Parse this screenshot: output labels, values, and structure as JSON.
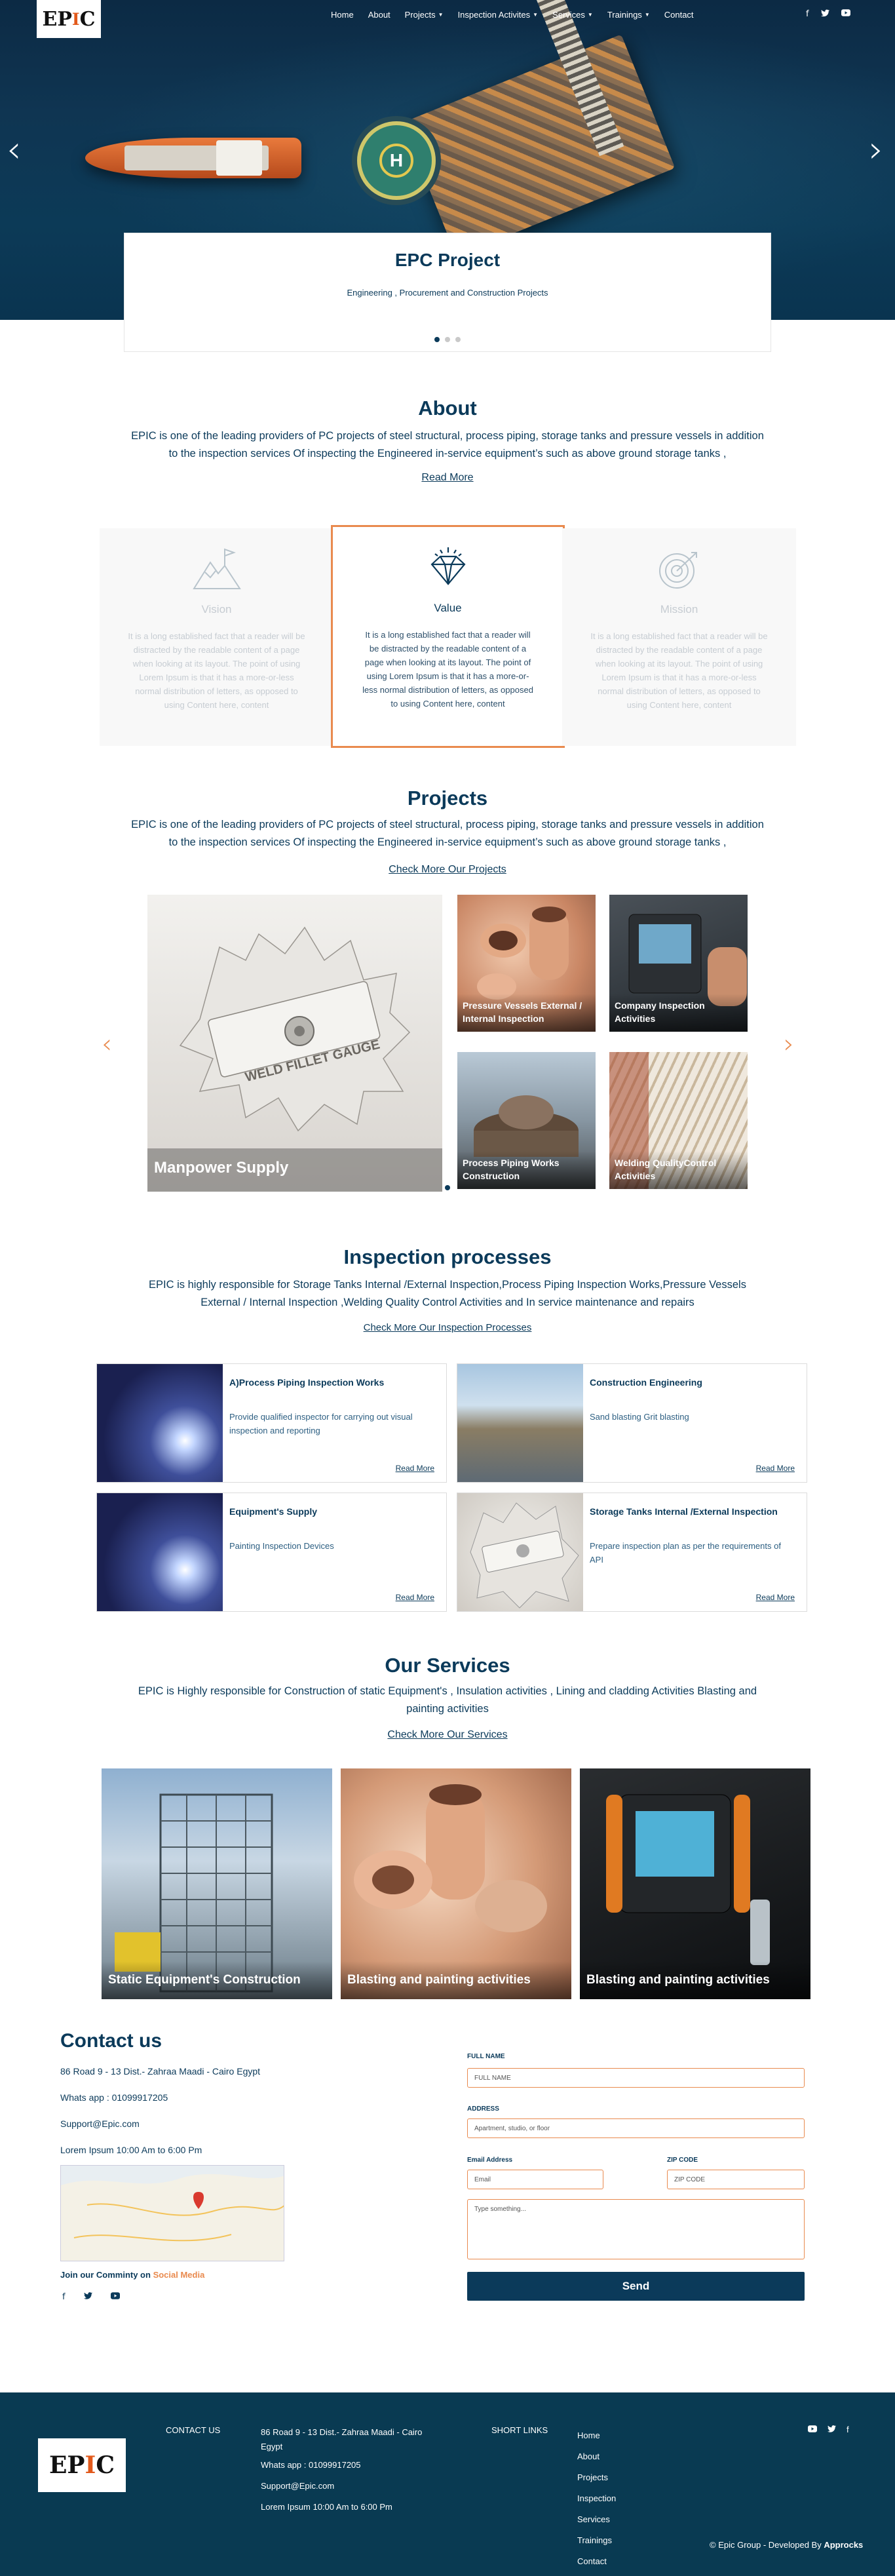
{
  "brand": {
    "logo_main": "EP",
    "logo_accent": "I",
    "logo_end": "C"
  },
  "nav": {
    "items": [
      {
        "label": "Home",
        "dropdown": false
      },
      {
        "label": "About",
        "dropdown": false
      },
      {
        "label": "Projects",
        "dropdown": true
      },
      {
        "label": "Inspection Activites",
        "dropdown": true
      },
      {
        "label": "Services",
        "dropdown": true
      },
      {
        "label": "Trainings",
        "dropdown": true
      },
      {
        "label": "Contact",
        "dropdown": false
      }
    ]
  },
  "hero": {
    "title": "EPC Project",
    "subtitle": "Engineering , Procurement and Construction Projects",
    "helipad": "H",
    "prev": "‹",
    "next": "›"
  },
  "about": {
    "title": "About",
    "text": "EPIC is one of the leading providers of PC projects of steel structural, process piping, storage tanks and pressure vessels in addition to the inspection services Of inspecting the Engineered in-service equipment’s such as above ground storage tanks ,",
    "link": "Read More",
    "cards": [
      {
        "title": "Vision",
        "text": "It is a long established fact that a reader will be distracted by the readable content of a page when looking at its layout. The point of using Lorem Ipsum is that it has a more-or-less normal distribution of letters, as opposed to using Content here, content"
      },
      {
        "title": "Value",
        "text": "It is a long established fact that a reader will be distracted by the readable content of a page when looking at its layout. The point of using Lorem Ipsum is that it has a more-or-less normal distribution of letters, as opposed to using Content here, content"
      },
      {
        "title": "Mission",
        "text": "It is a long established fact that a reader will be distracted by the readable content of a page when looking at its layout. The point of using Lorem Ipsum is that it has a more-or-less normal distribution of letters, as opposed to using Content here, content"
      }
    ]
  },
  "projects": {
    "title": "Projects",
    "text": "EPIC is one of the leading providers of PC projects of steel structural, process piping, storage tanks and pressure vessels in addition to the inspection services  Of inspecting the Engineered in-service equipment’s such as above ground storage tanks ,",
    "link": "Check More Our Projects",
    "big": "Manpower Supply",
    "tiles": [
      "Pressure Vessels External / Internal Inspection",
      "Company Inspection Activities",
      "Process Piping Works Construction",
      "Welding QualityControl Activities"
    ],
    "gauge_text": "WELD FILLET GAUGE",
    "prev": "‹",
    "next": "›"
  },
  "inspection": {
    "title": "Inspection processes",
    "text": "EPIC is highly responsible for Storage Tanks Internal /External Inspection,Process Piping Inspection Works,Pressure Vessels External / Internal Inspection ,Welding Quality Control Activities and In service maintenance and repairs",
    "link": "Check More Our Inspection Processes",
    "cards": [
      {
        "title": "A)Process Piping Inspection Works",
        "text": "Provide qualified inspector for carrying out visual inspection and reporting",
        "more": "Read More"
      },
      {
        "title": "Construction Engineering",
        "text": "Sand blasting Grit blasting",
        "more": "Read More"
      },
      {
        "title": "Equipment's Supply",
        "text": "Painting Inspection Devices",
        "more": "Read More"
      },
      {
        "title": "Storage Tanks Internal /External Inspection",
        "text": "Prepare inspection plan as per the requirements of API",
        "more": "Read More"
      }
    ]
  },
  "services": {
    "title": "Our Services",
    "text": "EPIC is Highly responsible for Construction of static Equipment's , Insulation activities , Lining and cladding Activities Blasting and painting activities",
    "link": "Check More Our Services",
    "cards": [
      "Static Equipment's Construction",
      "Blasting and painting activities",
      "Blasting and painting activities"
    ]
  },
  "contact": {
    "title": "Contact us",
    "address": "86 Road 9 - 13 Dist.- Zahraa Maadi - Cairo Egypt",
    "whatsapp": "Whats app : 01099917205",
    "email": "Support@Epic.com",
    "hours": "Lorem Ipsum 10:00 Am to 6:00 Pm",
    "join": "Join our Comminty on ",
    "join_accent": "Social Media",
    "form": {
      "name_label": "FULL NAME",
      "name_ph": "FULL NAME",
      "address_label": "ADDRESS",
      "address_ph": "Apartment, studio, or floor",
      "email_label": "Email Address",
      "email_ph": "Email",
      "zip_label": "ZIP CODE",
      "zip_ph": "ZIP CODE",
      "message_ph": "Type something...",
      "send": "Send"
    }
  },
  "footer": {
    "contact_head": "CONTACT US",
    "address": "86 Road 9 - 13 Dist.- Zahraa Maadi - Cairo Egypt",
    "whatsapp": "Whats app : 01099917205",
    "email": "Support@Epic.com",
    "hours": "Lorem Ipsum 10:00 Am to 6:00 Pm",
    "links_head": "SHORT LINKS",
    "links": [
      "Home",
      "About",
      "Projects",
      "Inspection",
      "Services",
      "Trainings",
      "Contact"
    ],
    "copyright": "© Epic Group - Developed By ",
    "dev": "Approcks"
  },
  "colors": {
    "primary": "#0b3a5a",
    "accent": "#e98a4e",
    "footer": "#093a52"
  },
  "icons": [
    "facebook-icon",
    "twitter-icon",
    "youtube-icon"
  ]
}
